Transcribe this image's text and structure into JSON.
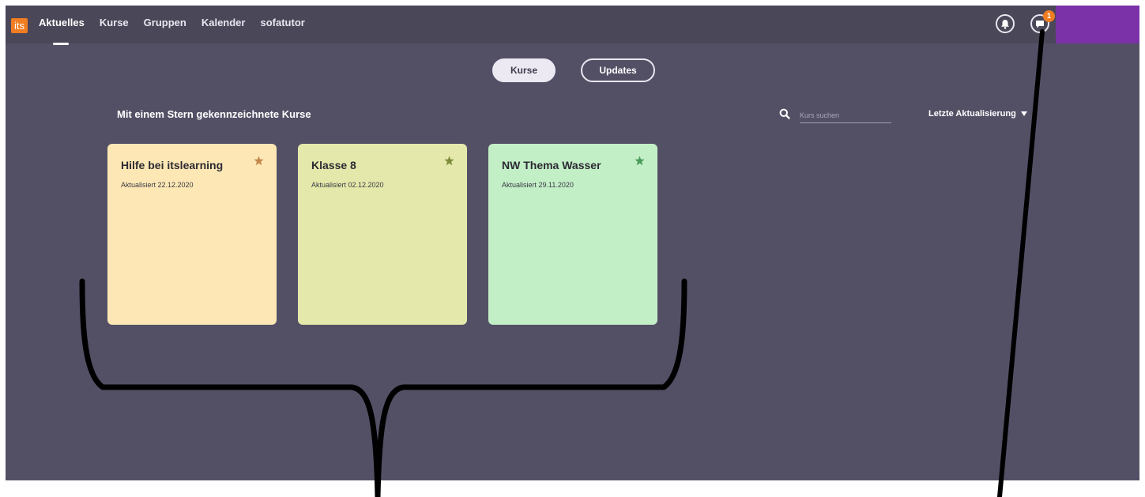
{
  "topbar": {
    "logo_text": "its",
    "nav": [
      "Aktuelles",
      "Kurse",
      "Gruppen",
      "Kalender",
      "sofatutor"
    ],
    "active_nav": "Aktuelles",
    "notification_badge": "1",
    "accent_purple": "#7b32a8",
    "logo_color": "#f07d22"
  },
  "toggle": {
    "kurse_label": "Kurse",
    "updates_label": "Updates"
  },
  "section": {
    "title": "Mit einem Stern gekennzeichnete Kurse",
    "search_placeholder": "Kurs suchen",
    "sort_label": "Letzte Aktualisierung"
  },
  "cards": [
    {
      "title": "Hilfe bei itslearning",
      "updated": "Aktualisiert 22.12.2020",
      "bg": "#fde8b5",
      "star": "#c5874c"
    },
    {
      "title": "Klasse 8",
      "updated": "Aktualisiert 02.12.2020",
      "bg": "#e4e9ab",
      "star": "#7c8a3a"
    },
    {
      "title": "NW Thema Wasser",
      "updated": "Aktualisiert 29.11.2020",
      "bg": "#c3efc7",
      "star": "#4a9a5a"
    }
  ],
  "icons": {
    "bell": "bell-icon",
    "chat": "chat-icon",
    "search": "search-icon",
    "star": "star-icon",
    "sort": "caret-down-icon"
  }
}
